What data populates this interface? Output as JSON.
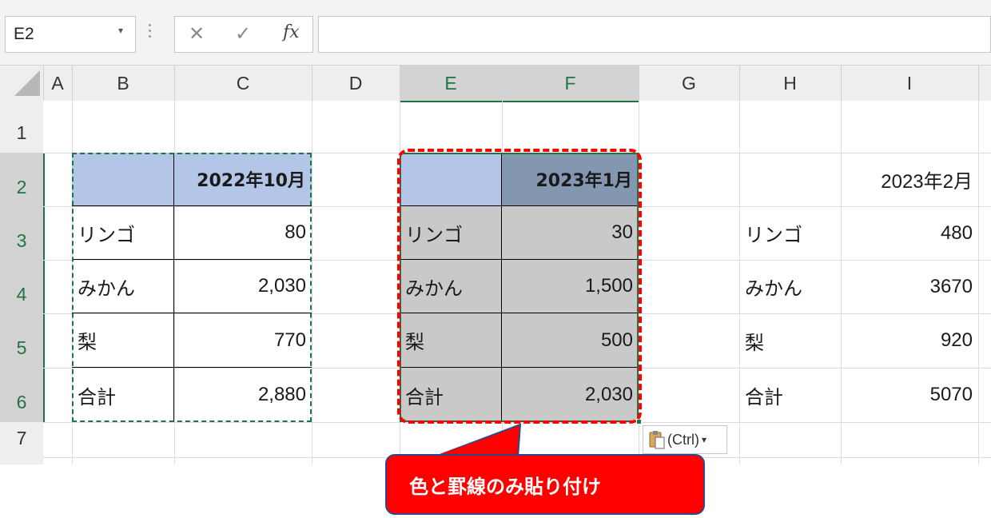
{
  "name_box": {
    "value": "E2",
    "dropdown_glyph": "▾"
  },
  "formula_bar": {
    "cancel_glyph": "✕",
    "enter_glyph": "✓",
    "fx_label": "fx",
    "formula": ""
  },
  "columns": [
    "A",
    "B",
    "C",
    "D",
    "E",
    "F",
    "G",
    "H",
    "I"
  ],
  "rows": [
    "1",
    "2",
    "3",
    "4",
    "5",
    "6",
    "7"
  ],
  "table1": {
    "header": "2022年10月",
    "items": [
      {
        "label": "リンゴ",
        "value": "80"
      },
      {
        "label": "みかん",
        "value": "2,030"
      },
      {
        "label": "梨",
        "value": "770"
      },
      {
        "label": "合計",
        "value": "2,880"
      }
    ]
  },
  "table2": {
    "header": "2023年1月",
    "items": [
      {
        "label": "リンゴ",
        "value": "30"
      },
      {
        "label": "みかん",
        "value": "1,500"
      },
      {
        "label": "梨",
        "value": "500"
      },
      {
        "label": "合計",
        "value": "2,030"
      }
    ]
  },
  "table3": {
    "header": "2023年2月",
    "items": [
      {
        "label": "リンゴ",
        "value": "480"
      },
      {
        "label": "みかん",
        "value": "3670"
      },
      {
        "label": "梨",
        "value": "920"
      },
      {
        "label": "合計",
        "value": "5070"
      }
    ]
  },
  "paste_options": {
    "label": "(Ctrl)",
    "icon": "clipboard-icon",
    "arrow": "▾"
  },
  "callout": {
    "text": "色と罫線のみ貼り付け"
  },
  "colors": {
    "accent_green": "#217346",
    "header_blue": "#b4c6e7",
    "header_slate": "#8497b0",
    "selection_gray": "#c9c9c9",
    "marching_ants": "#217346",
    "callout_red": "#ff0000"
  }
}
